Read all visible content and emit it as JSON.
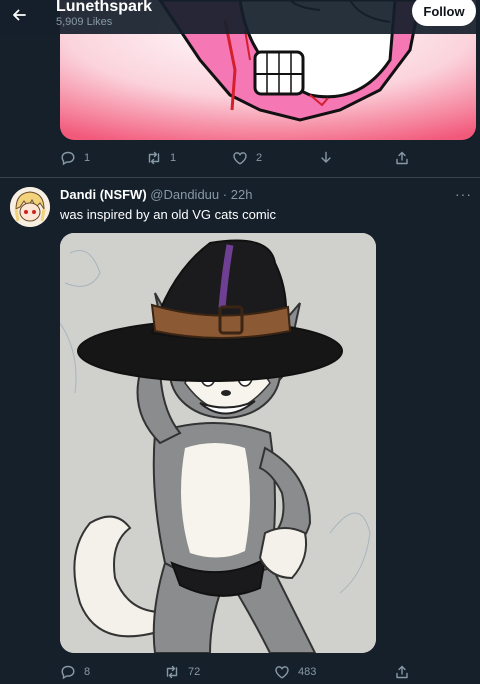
{
  "header": {
    "profile_name": "Lunethspark",
    "likes_count": "5,909 Likes",
    "follow_label": "Follow"
  },
  "tweet1": {
    "replies": "1",
    "retweets": "1",
    "likes": "2"
  },
  "tweet2": {
    "display_name": "Dandi (NSFW)",
    "handle": "@Dandiduu",
    "time": "22h",
    "text": "was inspired by an old VG cats comic",
    "replies": "8",
    "retweets": "72",
    "likes": "483",
    "more_label": "···"
  },
  "icons": [
    "back-arrow-icon",
    "reply-icon",
    "retweet-icon",
    "like-icon",
    "download-icon",
    "share-icon",
    "more-icon"
  ],
  "colors": {
    "background": "#15202b",
    "muted_text": "#8899a6",
    "divider": "#38444d",
    "follow_bg": "#ffffff"
  }
}
